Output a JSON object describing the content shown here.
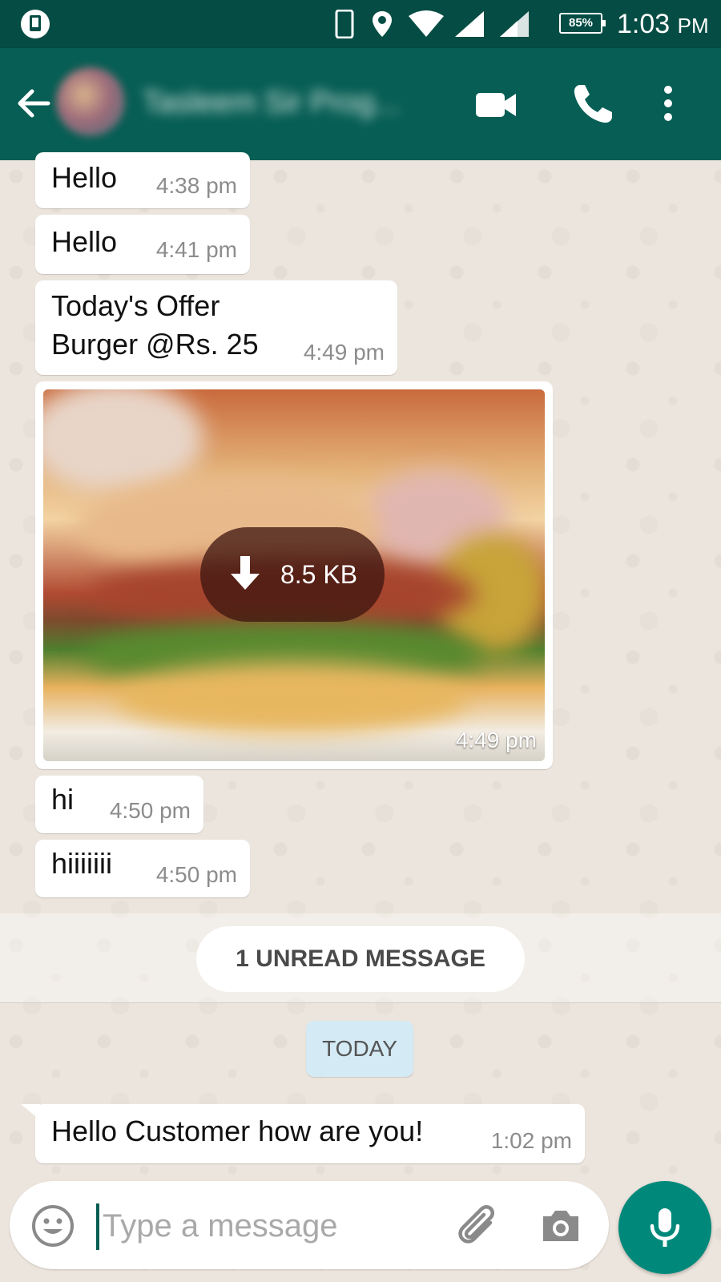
{
  "status_bar": {
    "battery": "85%",
    "time": "1:03",
    "ampm": "PM"
  },
  "header": {
    "contact_name": "Tasleem Sir Prog...",
    "icons": [
      "back-arrow-icon",
      "video-call-icon",
      "phone-icon",
      "more-vert-icon"
    ]
  },
  "messages": [
    {
      "text": "Hello",
      "time": "4:38 pm"
    },
    {
      "text": "Hello",
      "time": "4:41 pm"
    },
    {
      "line1": "Today's Offer",
      "line2": "Burger @Rs. 25",
      "time": "4:49 pm"
    },
    {
      "download_size": "8.5 KB",
      "time": "4:49 pm"
    },
    {
      "text": "hi",
      "time": "4:50 pm"
    },
    {
      "text": "hiiiiiii",
      "time": "4:50 pm"
    }
  ],
  "unread_banner": "1 UNREAD MESSAGE",
  "date_divider": "TODAY",
  "incoming": {
    "text": "Hello Customer how are you!",
    "time": "1:02 pm"
  },
  "composer": {
    "placeholder": "Type a message",
    "icons": [
      "emoji-icon",
      "attach-icon",
      "camera-icon",
      "mic-icon"
    ]
  },
  "colors": {
    "header": "#075e54",
    "status_bar": "#054d44",
    "chat_background": "#ece5dd",
    "mic_button": "#00897b"
  }
}
